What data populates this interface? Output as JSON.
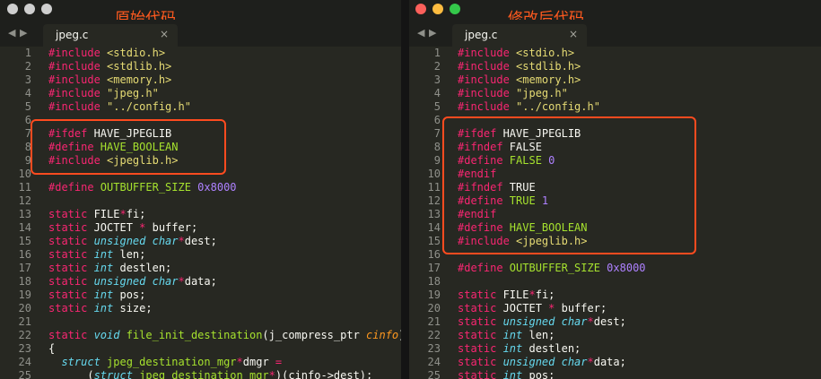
{
  "colors": {
    "keyword": "#f92672",
    "string": "#e6db74",
    "type": "#66d9ef",
    "function": "#a6e22e",
    "number": "#ae81ff",
    "param": "#fd971f",
    "text": "#f8f8f2",
    "line_number": "#8f908a",
    "editor_background": "#272822",
    "annotation": "#ff5a1f",
    "highlight_box": "#ff4b1f"
  },
  "icons": {
    "nav_left": "◀",
    "nav_right": "▶",
    "close": "×"
  },
  "left_pane": {
    "caption": "原始代码",
    "tab_label": "jpeg.c",
    "lines": [
      {
        "n": "1",
        "tokens": [
          [
            "k",
            "#include "
          ],
          [
            "s",
            "<stdio.h>"
          ]
        ]
      },
      {
        "n": "2",
        "tokens": [
          [
            "k",
            "#include "
          ],
          [
            "s",
            "<stdlib.h>"
          ]
        ]
      },
      {
        "n": "3",
        "tokens": [
          [
            "k",
            "#include "
          ],
          [
            "s",
            "<memory.h>"
          ]
        ]
      },
      {
        "n": "4",
        "tokens": [
          [
            "k",
            "#include "
          ],
          [
            "s",
            "\"jpeg.h\""
          ]
        ]
      },
      {
        "n": "5",
        "tokens": [
          [
            "k",
            "#include "
          ],
          [
            "s",
            "\"../config.h\""
          ]
        ]
      },
      {
        "n": "6",
        "tokens": []
      },
      {
        "n": "7",
        "tokens": [
          [
            "k",
            "#ifdef "
          ],
          [
            "w",
            "HAVE_JPEGLIB"
          ]
        ]
      },
      {
        "n": "8",
        "tokens": [
          [
            "k",
            "#define "
          ],
          [
            "f",
            "HAVE_BOOLEAN"
          ]
        ]
      },
      {
        "n": "9",
        "tokens": [
          [
            "k",
            "#include "
          ],
          [
            "s",
            "<jpeglib.h>"
          ]
        ]
      },
      {
        "n": "10",
        "tokens": []
      },
      {
        "n": "11",
        "tokens": [
          [
            "k",
            "#define "
          ],
          [
            "f",
            "OUTBUFFER_SIZE "
          ],
          [
            "n",
            "0x8000"
          ]
        ]
      },
      {
        "n": "12",
        "tokens": []
      },
      {
        "n": "13",
        "tokens": [
          [
            "k",
            "static "
          ],
          [
            "w",
            "FILE"
          ],
          [
            "k",
            "*"
          ],
          [
            "w",
            "fi;"
          ]
        ]
      },
      {
        "n": "14",
        "tokens": [
          [
            "k",
            "static "
          ],
          [
            "w",
            "JOCTET "
          ],
          [
            "k",
            "* "
          ],
          [
            "w",
            "buffer;"
          ]
        ]
      },
      {
        "n": "15",
        "tokens": [
          [
            "k",
            "static "
          ],
          [
            "t",
            "unsigned char"
          ],
          [
            "k",
            "*"
          ],
          [
            "w",
            "dest;"
          ]
        ]
      },
      {
        "n": "16",
        "tokens": [
          [
            "k",
            "static "
          ],
          [
            "t",
            "int "
          ],
          [
            "w",
            "len;"
          ]
        ]
      },
      {
        "n": "17",
        "tokens": [
          [
            "k",
            "static "
          ],
          [
            "t",
            "int "
          ],
          [
            "w",
            "destlen;"
          ]
        ]
      },
      {
        "n": "18",
        "tokens": [
          [
            "k",
            "static "
          ],
          [
            "t",
            "unsigned char"
          ],
          [
            "k",
            "*"
          ],
          [
            "w",
            "data;"
          ]
        ]
      },
      {
        "n": "19",
        "tokens": [
          [
            "k",
            "static "
          ],
          [
            "t",
            "int "
          ],
          [
            "w",
            "pos;"
          ]
        ]
      },
      {
        "n": "20",
        "tokens": [
          [
            "k",
            "static "
          ],
          [
            "t",
            "int "
          ],
          [
            "w",
            "size;"
          ]
        ]
      },
      {
        "n": "21",
        "tokens": []
      },
      {
        "n": "22",
        "tokens": [
          [
            "k",
            "static "
          ],
          [
            "t",
            "void "
          ],
          [
            "f",
            "file_init_destination"
          ],
          [
            "w",
            "(j_compress_ptr "
          ],
          [
            "p",
            "cinfo"
          ],
          [
            "w",
            ")"
          ]
        ]
      },
      {
        "n": "23",
        "tokens": [
          [
            "w",
            "{"
          ]
        ]
      },
      {
        "n": "24",
        "tokens": [
          [
            "w",
            "  "
          ],
          [
            "t",
            "struct "
          ],
          [
            "f",
            "jpeg_destination_mgr"
          ],
          [
            "k",
            "*"
          ],
          [
            "w",
            "dmgr "
          ],
          [
            "k",
            "="
          ]
        ]
      },
      {
        "n": "25",
        "tokens": [
          [
            "w",
            "      ("
          ],
          [
            "t",
            "struct "
          ],
          [
            "f",
            "jpeg_destination_mgr"
          ],
          [
            "k",
            "*"
          ],
          [
            "w",
            ")(cinfo->dest);"
          ]
        ]
      }
    ]
  },
  "right_pane": {
    "caption": "修改后代码",
    "tab_label": "jpeg.c",
    "lines": [
      {
        "n": "1",
        "tokens": [
          [
            "k",
            "#include "
          ],
          [
            "s",
            "<stdio.h>"
          ]
        ]
      },
      {
        "n": "2",
        "tokens": [
          [
            "k",
            "#include "
          ],
          [
            "s",
            "<stdlib.h>"
          ]
        ]
      },
      {
        "n": "3",
        "tokens": [
          [
            "k",
            "#include "
          ],
          [
            "s",
            "<memory.h>"
          ]
        ]
      },
      {
        "n": "4",
        "tokens": [
          [
            "k",
            "#include "
          ],
          [
            "s",
            "\"jpeg.h\""
          ]
        ]
      },
      {
        "n": "5",
        "tokens": [
          [
            "k",
            "#include "
          ],
          [
            "s",
            "\"../config.h\""
          ]
        ]
      },
      {
        "n": "6",
        "tokens": []
      },
      {
        "n": "7",
        "tokens": [
          [
            "k",
            "#ifdef "
          ],
          [
            "w",
            "HAVE_JPEGLIB"
          ]
        ]
      },
      {
        "n": "8",
        "tokens": [
          [
            "k",
            "#ifndef "
          ],
          [
            "w",
            "FALSE"
          ]
        ]
      },
      {
        "n": "9",
        "tokens": [
          [
            "k",
            "#define "
          ],
          [
            "f",
            "FALSE "
          ],
          [
            "n",
            "0"
          ]
        ]
      },
      {
        "n": "10",
        "tokens": [
          [
            "k",
            "#endif"
          ]
        ]
      },
      {
        "n": "11",
        "tokens": [
          [
            "k",
            "#ifndef "
          ],
          [
            "w",
            "TRUE"
          ]
        ]
      },
      {
        "n": "12",
        "tokens": [
          [
            "k",
            "#define "
          ],
          [
            "f",
            "TRUE "
          ],
          [
            "n",
            "1"
          ]
        ]
      },
      {
        "n": "13",
        "tokens": [
          [
            "k",
            "#endif"
          ]
        ]
      },
      {
        "n": "14",
        "tokens": [
          [
            "k",
            "#define "
          ],
          [
            "f",
            "HAVE_BOOLEAN"
          ]
        ]
      },
      {
        "n": "15",
        "tokens": [
          [
            "k",
            "#include "
          ],
          [
            "s",
            "<jpeglib.h>"
          ]
        ]
      },
      {
        "n": "16",
        "tokens": []
      },
      {
        "n": "17",
        "tokens": [
          [
            "k",
            "#define "
          ],
          [
            "f",
            "OUTBUFFER_SIZE "
          ],
          [
            "n",
            "0x8000"
          ]
        ]
      },
      {
        "n": "18",
        "tokens": []
      },
      {
        "n": "19",
        "tokens": [
          [
            "k",
            "static "
          ],
          [
            "w",
            "FILE"
          ],
          [
            "k",
            "*"
          ],
          [
            "w",
            "fi;"
          ]
        ]
      },
      {
        "n": "20",
        "tokens": [
          [
            "k",
            "static "
          ],
          [
            "w",
            "JOCTET "
          ],
          [
            "k",
            "* "
          ],
          [
            "w",
            "buffer;"
          ]
        ]
      },
      {
        "n": "21",
        "tokens": [
          [
            "k",
            "static "
          ],
          [
            "t",
            "unsigned char"
          ],
          [
            "k",
            "*"
          ],
          [
            "w",
            "dest;"
          ]
        ]
      },
      {
        "n": "22",
        "tokens": [
          [
            "k",
            "static "
          ],
          [
            "t",
            "int "
          ],
          [
            "w",
            "len;"
          ]
        ]
      },
      {
        "n": "23",
        "tokens": [
          [
            "k",
            "static "
          ],
          [
            "t",
            "int "
          ],
          [
            "w",
            "destlen;"
          ]
        ]
      },
      {
        "n": "24",
        "tokens": [
          [
            "k",
            "static "
          ],
          [
            "t",
            "unsigned char"
          ],
          [
            "k",
            "*"
          ],
          [
            "w",
            "data;"
          ]
        ]
      },
      {
        "n": "25",
        "tokens": [
          [
            "k",
            "static "
          ],
          [
            "t",
            "int "
          ],
          [
            "w",
            "pos;"
          ]
        ]
      }
    ]
  }
}
